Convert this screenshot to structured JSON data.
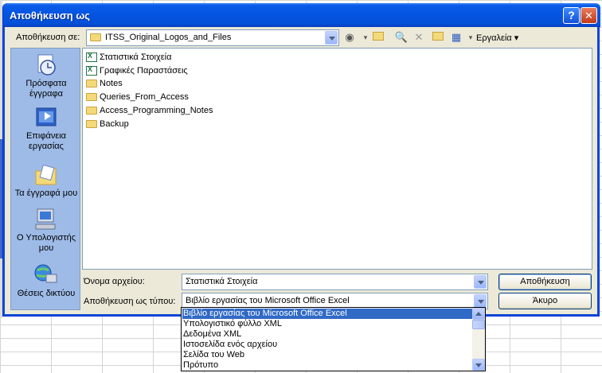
{
  "window": {
    "title": "Αποθήκευση ως",
    "help_glyph": "?",
    "close_glyph": "✕"
  },
  "savein": {
    "label": "Αποθήκευση σε:",
    "value": "ITSS_Original_Logos_and_Files"
  },
  "toolbar": {
    "tools_label": "Εργαλεία"
  },
  "places": [
    {
      "label": "Πρόσφατα έγγραφα",
      "icon": "recent-documents-icon"
    },
    {
      "label": "Επιφάνεια εργασίας",
      "icon": "desktop-icon"
    },
    {
      "label": "Τα έγγραφά μου",
      "icon": "my-documents-icon"
    },
    {
      "label": "Ο Υπολογιστής μου",
      "icon": "my-computer-icon"
    },
    {
      "label": "Θέσεις δικτύου",
      "icon": "network-places-icon"
    }
  ],
  "files": [
    {
      "name": "Στατιστικά Στοιχεία",
      "type": "excel"
    },
    {
      "name": "Γραφικές Παραστάσεις",
      "type": "excel"
    },
    {
      "name": "Notes",
      "type": "folder"
    },
    {
      "name": "Queries_From_Access",
      "type": "folder"
    },
    {
      "name": "Access_Programming_Notes",
      "type": "folder"
    },
    {
      "name": "Backup",
      "type": "folder"
    }
  ],
  "filename": {
    "label": "Όνομα αρχείου:",
    "value": "Στατιστικά Στοιχεία"
  },
  "savetype": {
    "label": "Αποθήκευση ως τύπου:",
    "value": "Βιβλίο εργασίας του Microsoft Office Excel"
  },
  "buttons": {
    "save": "Αποθήκευση",
    "cancel": "Άκυρο"
  },
  "type_options": [
    "Βιβλίο εργασίας του Microsoft Office Excel",
    "Υπολογιστικό φύλλο XML",
    "Δεδομένα XML",
    "Ιστοσελίδα ενός αρχείου",
    "Σελίδα του Web",
    "Πρότυπο"
  ],
  "colors": {
    "titlebar": "#0454e0",
    "selection": "#316ac5",
    "places_bg": "#9ebbe8",
    "dialog_bg": "#ece9d8"
  }
}
